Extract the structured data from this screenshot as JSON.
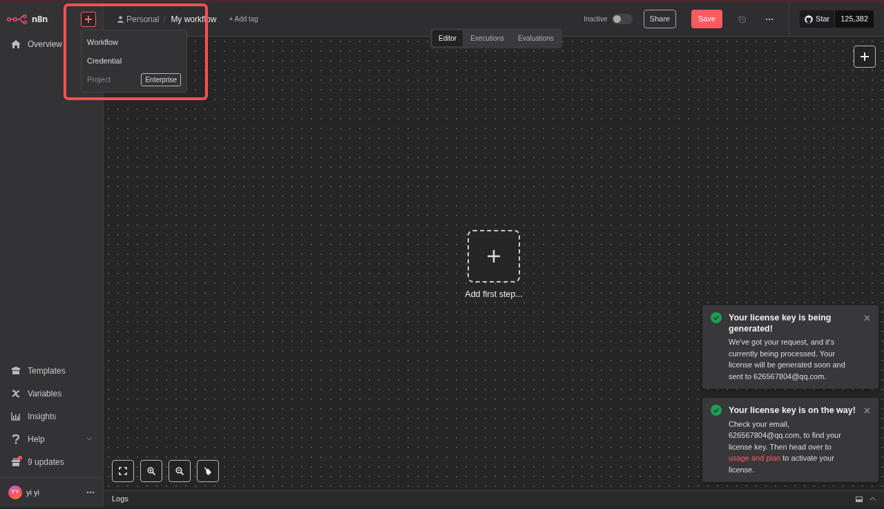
{
  "app": {
    "name": "n8n"
  },
  "create_menu": [
    {
      "label": "Workflow",
      "disabled": false
    },
    {
      "label": "Credential",
      "disabled": false
    },
    {
      "label": "Project",
      "disabled": true,
      "badge": "Enterprise"
    }
  ],
  "annotation": {
    "kind": "highlight"
  },
  "sidebar": {
    "top_items": [
      {
        "label": "Overview"
      }
    ],
    "bottom_items": [
      {
        "label": "Templates",
        "expandable": false,
        "notification": false
      },
      {
        "label": "Variables",
        "expandable": false,
        "notification": false
      },
      {
        "label": "Insights",
        "expandable": false,
        "notification": false
      },
      {
        "label": "Help",
        "expandable": true,
        "notification": false
      },
      {
        "label": "9 updates",
        "expandable": false,
        "notification": true
      }
    ],
    "user": {
      "initials": "YY",
      "name": "yi yi"
    }
  },
  "breadcrumb": {
    "project": "Personal",
    "workflow": "My workflow"
  },
  "add_tag": "+ Add tag",
  "view_tabs": [
    {
      "label": "Editor",
      "selected": true
    },
    {
      "label": "Executions",
      "selected": false
    },
    {
      "label": "Evaluations",
      "selected": false
    }
  ],
  "status": {
    "label": "Inactive",
    "on": false
  },
  "buttons": {
    "share": "Share",
    "save": "Save"
  },
  "github": {
    "label": "Star",
    "count": "125,382"
  },
  "canvas": {
    "add_first_step": "Add first step..."
  },
  "logs": {
    "label": "Logs"
  },
  "toasts": [
    {
      "title": "Your license key is being generated!",
      "body": "We've got your request, and it's currently being processed. Your license will be generated soon and sent to 626567804@qq.com."
    },
    {
      "title": "Your license key is on the way!",
      "body": "Check your email, 626567804@qq.com, to find your license key. Then head over to",
      "link": "usage and plan",
      "body_after": "to activate your license."
    }
  ]
}
